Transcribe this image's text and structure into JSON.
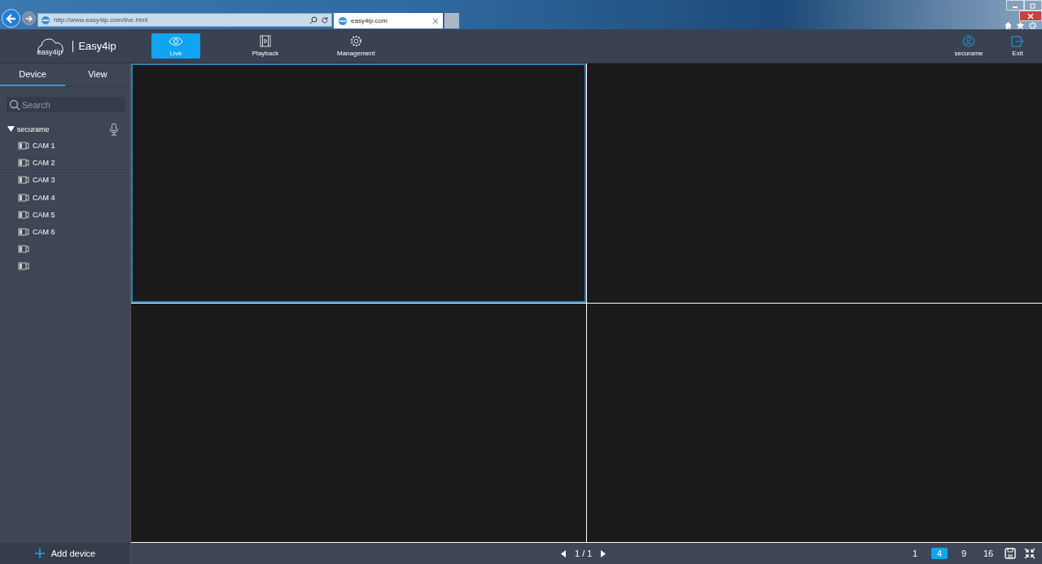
{
  "browser": {
    "address": "http://www.easy4ip.com/live.html",
    "tab": {
      "title": "easy4ip.com"
    }
  },
  "header": {
    "logo_badge": "easy4ip",
    "brand": "Easy4ip",
    "nav": [
      {
        "label": "Live",
        "kind": "live",
        "selected": true
      },
      {
        "label": "Playback",
        "kind": "playback",
        "selected": false
      },
      {
        "label": "Management",
        "kind": "management",
        "selected": false
      }
    ],
    "user": "securame",
    "exit": "Exit"
  },
  "sidebar": {
    "tabs": [
      {
        "label": "Device",
        "selected": true
      },
      {
        "label": "View",
        "selected": false
      }
    ],
    "search": {
      "placeholder": "Search"
    },
    "tree": {
      "label": "securame",
      "expanded": true,
      "children": [
        {
          "kind": "camera",
          "label": "CAM 1"
        },
        {
          "kind": "camera",
          "label": "CAM 2"
        },
        {
          "kind": "camera",
          "label": "CAM 3"
        },
        {
          "kind": "camera",
          "label": "CAM 4"
        },
        {
          "kind": "camera",
          "label": "CAM 5"
        },
        {
          "kind": "camera",
          "label": "CAM 6"
        },
        {
          "kind": "camera"
        },
        {
          "kind": "camera"
        }
      ]
    },
    "add_device": "Add device"
  },
  "video_panes": [
    {
      "selected": true
    },
    {
      "selected": false
    },
    {
      "selected": false
    },
    {
      "selected": false
    }
  ],
  "footer": {
    "page": "1 / 1",
    "layouts": [
      {
        "label": "1",
        "selected": false
      },
      {
        "label": "4",
        "selected": true
      },
      {
        "label": "9",
        "selected": false
      },
      {
        "label": "16",
        "selected": false
      }
    ]
  }
}
